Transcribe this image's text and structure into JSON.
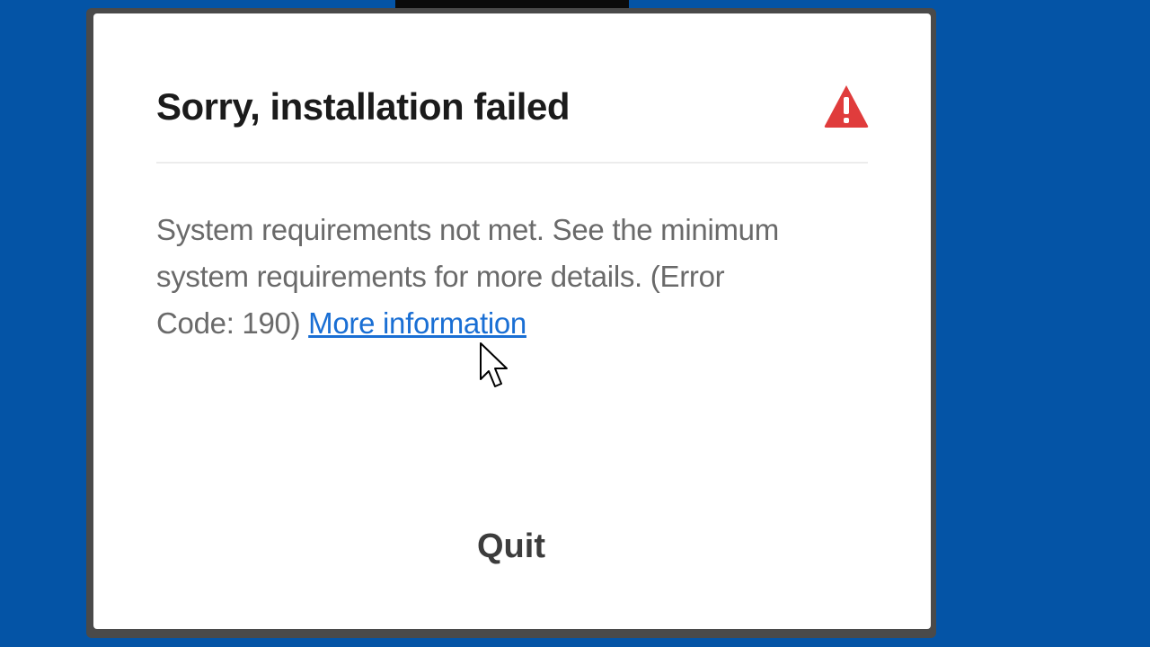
{
  "dialog": {
    "title": "Sorry, installation failed",
    "icon": "warning-icon",
    "message": "System requirements not met. See the minimum system requirements for more details. (Error Code: 190)",
    "link_text": "More information",
    "quit_label": "Quit"
  },
  "colors": {
    "background": "#0454a6",
    "warning": "#e03c3c",
    "link": "#1a6fd4"
  }
}
